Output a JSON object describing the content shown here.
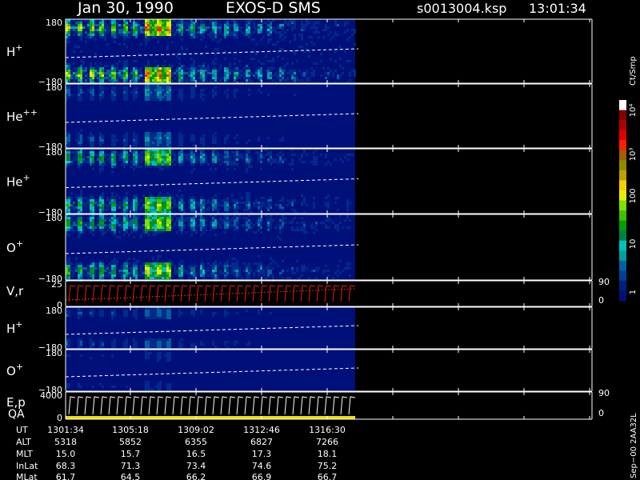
{
  "header": {
    "date": "Jan 30, 1990",
    "instrument": "EXOS-D SMS",
    "file": "s0013004.ksp",
    "time": "13:01:34"
  },
  "panels": [
    {
      "key": "Hp",
      "label": "H",
      "sup": "+",
      "ytop": "180",
      "ybot": "−180"
    },
    {
      "key": "Hepp",
      "label": "He",
      "sup": "++",
      "ytop": "180",
      "ybot": "−180"
    },
    {
      "key": "Hep",
      "label": "He",
      "sup": "+",
      "ytop": "180",
      "ybot": "−180"
    },
    {
      "key": "Op",
      "label": "O",
      "sup": "+",
      "ytop": "180",
      "ybot": "−180"
    },
    {
      "key": "Vr",
      "label": "V,r",
      "sup": "",
      "ytop": "25",
      "ybot": "0",
      "rtop": "90",
      "rbot": "0"
    },
    {
      "key": "Hp2",
      "label": "H",
      "sup": "+",
      "ytop": "180",
      "ybot": "−180"
    },
    {
      "key": "Op2",
      "label": "O",
      "sup": "+",
      "ytop": "180",
      "ybot": "−180"
    },
    {
      "key": "Ep",
      "label": "E,p",
      "label2": "QA",
      "sup": "",
      "ytop": "4000",
      "ybot": "0",
      "rtop": "90",
      "rbot": "0"
    }
  ],
  "colorbar": {
    "unit": "Ct/Smp",
    "ticks": [
      "10⁴",
      "10³",
      "100",
      "10",
      "1"
    ],
    "colors": [
      "#ffffff",
      "#800000",
      "#b00000",
      "#e00000",
      "#ff2000",
      "#a06000",
      "#8c8c00",
      "#c0a000",
      "#f0d000",
      "#e8f000",
      "#80e000",
      "#40c000",
      "#00a000",
      "#008040",
      "#00c0c0",
      "#00a0a0",
      "#0060a0",
      "#004090",
      "#002080",
      "#00107a"
    ]
  },
  "footer": {
    "row_labels": [
      "UT",
      "ALT",
      "MLT",
      "InLat",
      "MLat"
    ],
    "columns": [
      {
        "UT": "1301:34",
        "ALT": "5318",
        "MLT": "15.0",
        "InLat": "68.3",
        "MLat": "61.7"
      },
      {
        "UT": "1305:18",
        "ALT": "5852",
        "MLT": "15.7",
        "InLat": "71.3",
        "MLat": "64.5"
      },
      {
        "UT": "1309:02",
        "ALT": "6355",
        "MLT": "16.5",
        "InLat": "73.4",
        "MLat": "66.2"
      },
      {
        "UT": "1312:46",
        "ALT": "6827",
        "MLT": "17.3",
        "InLat": "74.6",
        "MLat": "66.9"
      },
      {
        "UT": "1316:30",
        "ALT": "7266",
        "MLT": "18.1",
        "InLat": "75.2",
        "MLat": "66.7"
      }
    ],
    "stamp": "Sep−00  2AA32L"
  },
  "chart_data": {
    "type": "heatmap",
    "title": "Jan 30, 1990   EXOS-D SMS",
    "xlabel": "UT",
    "x_ticks": [
      "1301:34",
      "1305:18",
      "1309:02",
      "1312:46",
      "1316:30"
    ],
    "data_extent_ut": [
      "1301:34",
      "1319:00"
    ],
    "color_scale": "log",
    "color_range": [
      1,
      10000
    ],
    "colorbar_label": "Ct/Smp",
    "series": [
      {
        "name": "H+",
        "ylim": [
          -180,
          180
        ],
        "intensity": "high"
      },
      {
        "name": "He++",
        "ylim": [
          -180,
          180
        ],
        "intensity": "low"
      },
      {
        "name": "He+",
        "ylim": [
          -180,
          180
        ],
        "intensity": "medium"
      },
      {
        "name": "O+",
        "ylim": [
          -180,
          180
        ],
        "intensity": "medium"
      },
      {
        "name": "V,r",
        "ylim": [
          0,
          25
        ],
        "right_ylim": [
          0,
          90
        ],
        "kind": "line"
      },
      {
        "name": "H+",
        "ylim": [
          -180,
          180
        ],
        "intensity": "low"
      },
      {
        "name": "O+",
        "ylim": [
          -180,
          180
        ],
        "intensity": "very low"
      },
      {
        "name": "E,p / QA",
        "ylim": [
          0,
          4000
        ],
        "right_ylim": [
          0,
          90
        ],
        "kind": "line"
      }
    ]
  }
}
